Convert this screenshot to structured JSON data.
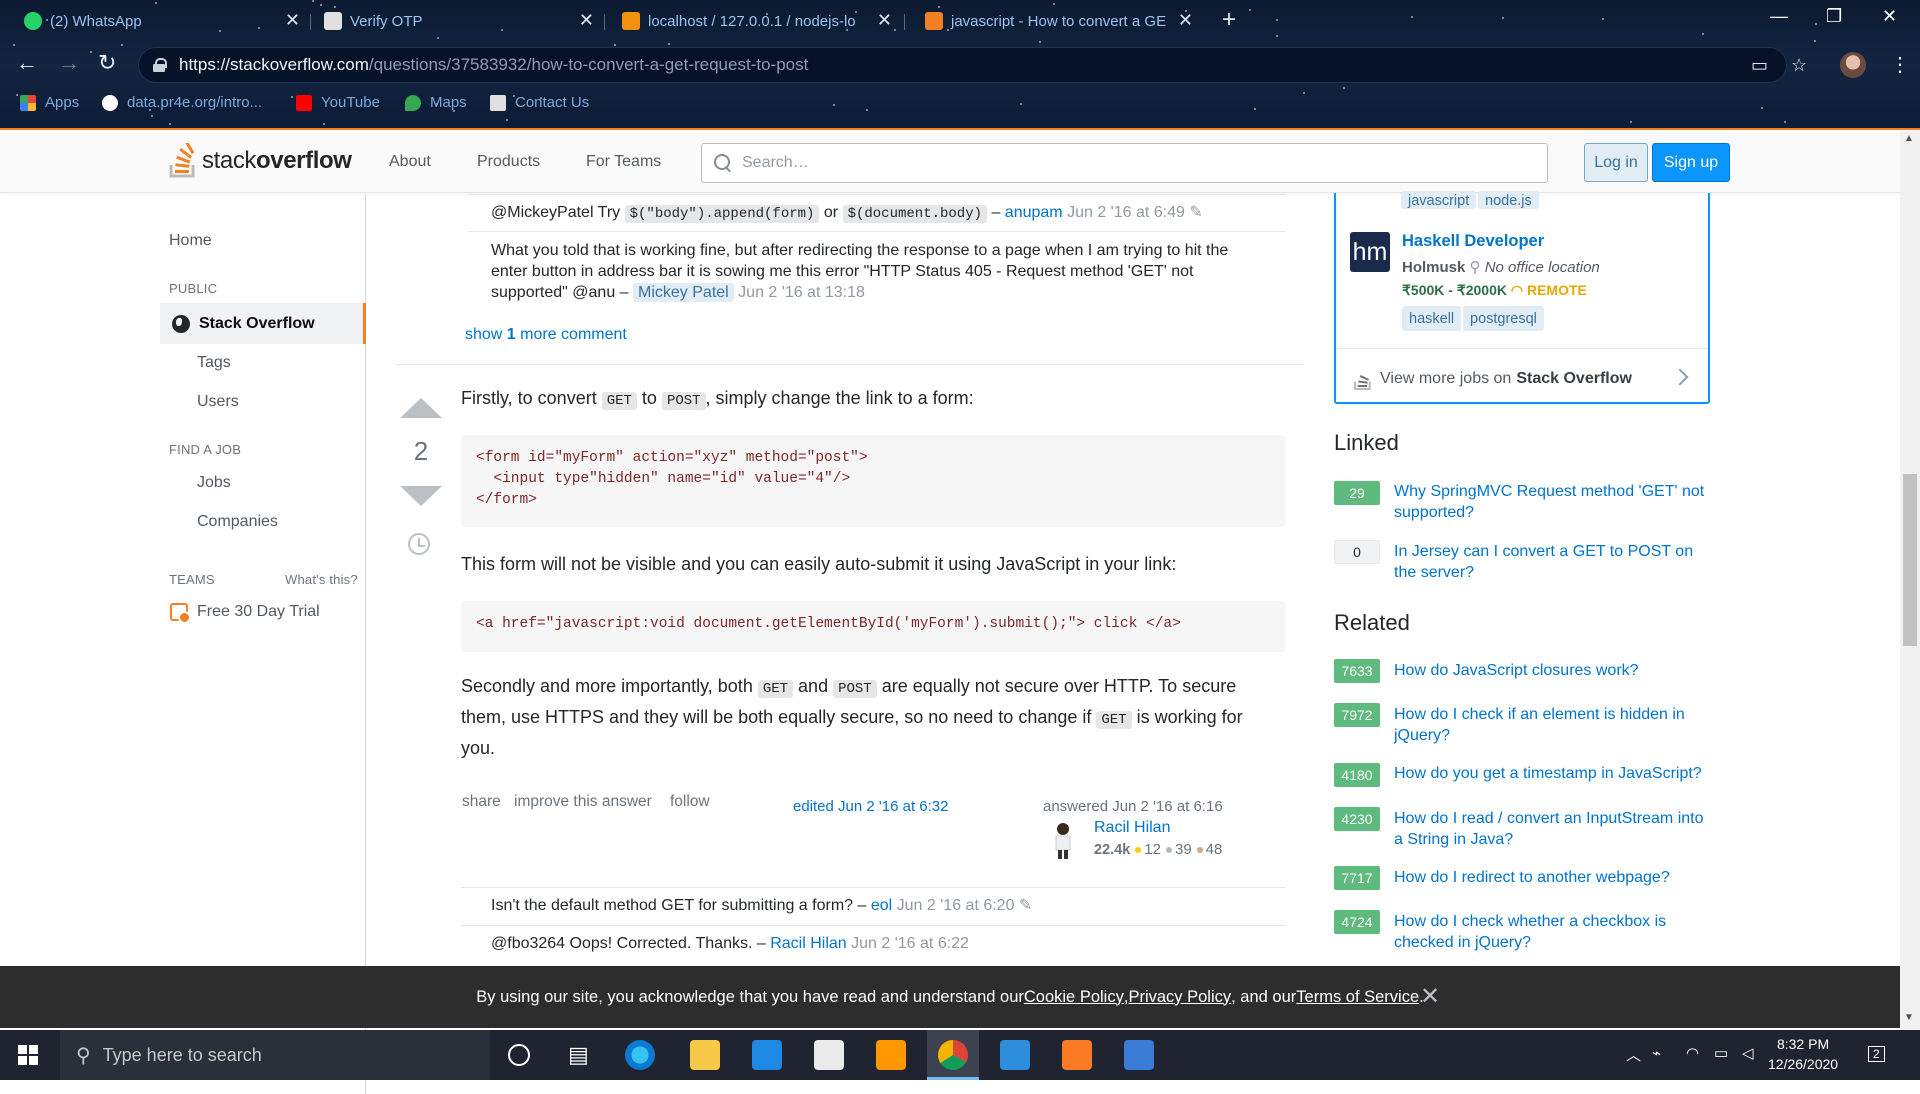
{
  "browser": {
    "tabs": [
      {
        "title": "(2) WhatsApp",
        "color": "#25d366"
      },
      {
        "title": "Verify OTP",
        "color": "#e0e0e0"
      },
      {
        "title": "localhost / 127.0.0.1 / nodejs-lo",
        "color": "#f29111"
      },
      {
        "title": "javascript - How to convert a GE",
        "color": "#f48024"
      }
    ],
    "url_host": "https://stackoverflow.com",
    "url_path": "/questions/37583932/how-to-convert-a-get-request-to-post",
    "bookmarks": [
      {
        "label": "Apps",
        "icon": "apps-grid-icon",
        "color": "#e8453c"
      },
      {
        "label": "data.pr4e.org/intro...",
        "icon": "globe-icon",
        "color": "#ffffff"
      },
      {
        "label": "YouTube",
        "icon": "youtube-icon",
        "color": "#ff0000"
      },
      {
        "label": "Maps",
        "icon": "maps-pin-icon",
        "color": "#34a853"
      },
      {
        "label": "Contact Us",
        "icon": "page-icon",
        "color": "#e0e0e0"
      }
    ]
  },
  "header": {
    "logo_prefix": "stack",
    "logo_suffix": "overflow",
    "nav": [
      "About",
      "Products",
      "For Teams"
    ],
    "search_placeholder": "Search…",
    "login": "Log in",
    "signup": "Sign up"
  },
  "leftnav": {
    "home": "Home",
    "public_label": "PUBLIC",
    "active": "Stack Overflow",
    "tags": "Tags",
    "users": "Users",
    "find_job_label": "FIND A JOB",
    "jobs": "Jobs",
    "companies": "Companies",
    "teams_label": "TEAMS",
    "whats_this": "What's this?",
    "trial": "Free 30 Day Trial"
  },
  "comments_top": {
    "c1": {
      "user_prefix": "@MickeyPatel Try ",
      "code1": "$(\"body\").append(form)",
      "mid": " or ",
      "code2": "$(document.body)",
      "dash": " – ",
      "author": "anupam",
      "time": "Jun 2 '16 at 6:49"
    },
    "c2": {
      "text": "What you told that is working fine, but after redirecting the response to a page when I am trying to hit the enter button in address bar it is sowing me this error \"HTTP Status 405 - Request method 'GET' not supported\" @anu – ",
      "author": "Mickey Patel",
      "time": "Jun 2 '16 at 13:18"
    },
    "show_more_prefix": "show ",
    "show_more_count": "1",
    "show_more_suffix": " more comment"
  },
  "answer": {
    "votes": "2",
    "p1_a": "Firstly, to convert ",
    "p1_code1": "GET",
    "p1_b": " to ",
    "p1_code2": "POST",
    "p1_c": ", simply change the link to a form:",
    "code1_line1": "<form id=\"myForm\" action=\"xyz\" method=\"post\">",
    "code1_line2": "  <input type\"hidden\" name=\"id\" value=\"4\"/>",
    "code1_line3": "</form>",
    "p2": "This form will not be visible and you can easily auto-submit it using JavaScript in your link:",
    "code2": "<a href=\"javascript:void document.getElementById('myForm').submit();\"> click </a>",
    "p3_a": "Secondly and more importantly, both ",
    "p3_code1": "GET",
    "p3_b": " and ",
    "p3_code2": "POST",
    "p3_c": " are equally not secure over HTTP. To secure them, use HTTPS and they will be both equally secure, so no need to change if ",
    "p3_code3": "GET",
    "p3_d": " is working for you.",
    "actions": [
      "share",
      "improve this answer",
      "follow"
    ],
    "edited": "edited Jun 2 '16 at 6:32",
    "answered": "answered Jun 2 '16 at 6:16",
    "author": "Racil Hilan",
    "rep": "22.4k",
    "gold": "12",
    "silver": "39",
    "bronze": "48",
    "badge_colors": {
      "gold": "#ffcc01",
      "silver": "#b4b8bc",
      "bronze": "#d1a684"
    }
  },
  "comments_bottom": {
    "c1": {
      "text": "Isn't the default method GET for submitting a form? – ",
      "author": "eol",
      "time": "Jun 2 '16 at 6:20"
    },
    "c2": {
      "text": "@fbo3264 Oops! Corrected. Thanks. – ",
      "author": "Racil Hilan",
      "time": "Jun 2 '16 at 6:22"
    }
  },
  "sidebar": {
    "job_top_tags": [
      "javascript",
      "node.js"
    ],
    "job": {
      "logo": "hm",
      "title": "Haskell Developer",
      "company": "Holmusk",
      "location": "No office location",
      "salary": "₹500K - ₹2000K",
      "remote": "REMOTE",
      "tags": [
        "haskell",
        "postgresql"
      ]
    },
    "view_more_prefix": "View more jobs on",
    "view_more_brand": "Stack Overflow",
    "linked_title": "Linked",
    "linked": [
      {
        "score": "29",
        "title": "Why SpringMVC Request method 'GET' not supported?",
        "accepted": true
      },
      {
        "score": "0",
        "title": "In Jersey can I convert a GET to POST on the server?",
        "accepted": false
      }
    ],
    "related_title": "Related",
    "related": [
      {
        "score": "7633",
        "title": "How do JavaScript closures work?"
      },
      {
        "score": "7972",
        "title": "How do I check if an element is hidden in jQuery?"
      },
      {
        "score": "4180",
        "title": "How do you get a timestamp in JavaScript?"
      },
      {
        "score": "4230",
        "title": "How do I read / convert an InputStream into a String in Java?"
      },
      {
        "score": "7717",
        "title": "How do I redirect to another webpage?"
      },
      {
        "score": "4724",
        "title": "How do I check whether a checkbox is checked in jQuery?"
      }
    ]
  },
  "cookie": {
    "prefix": "By using our site, you acknowledge that you have read and understand our ",
    "cookie_policy": "Cookie Policy",
    "sep1": ", ",
    "privacy_policy": "Privacy Policy",
    "sep2": ", and our ",
    "terms": "Terms of Service",
    "end": "."
  },
  "taskbar": {
    "search_placeholder": "Type here to search",
    "time": "8:32 PM",
    "date": "12/26/2020",
    "notifications": "2"
  }
}
